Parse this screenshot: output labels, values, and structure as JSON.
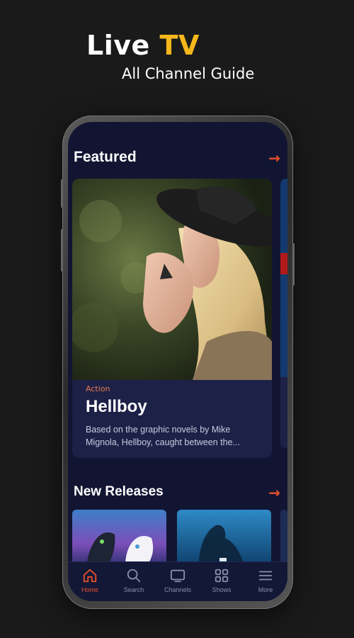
{
  "promo": {
    "title_main": "Live",
    "title_accent": "TV",
    "subtitle": "All Channel Guide"
  },
  "colors": {
    "accent_orange": "#e8512b",
    "accent_yellow": "#f5b71b",
    "screen_bg": "#121532",
    "card_bg": "#1d2147"
  },
  "featured": {
    "section_title": "Featured",
    "arrow": "→",
    "card": {
      "genre": "Action",
      "title": "Hellboy",
      "description": "Based on the graphic novels by Mike Mignola, Hellboy, caught between the..."
    }
  },
  "new_releases": {
    "section_title": "New Releases",
    "arrow": "→"
  },
  "bottom_nav": {
    "items": [
      {
        "label": "Home",
        "icon": "home-icon",
        "active": true
      },
      {
        "label": "Search",
        "icon": "search-icon",
        "active": false
      },
      {
        "label": "Channels",
        "icon": "tv-icon",
        "active": false
      },
      {
        "label": "Shows",
        "icon": "grid-icon",
        "active": false
      },
      {
        "label": "More",
        "icon": "menu-icon",
        "active": false
      }
    ]
  }
}
